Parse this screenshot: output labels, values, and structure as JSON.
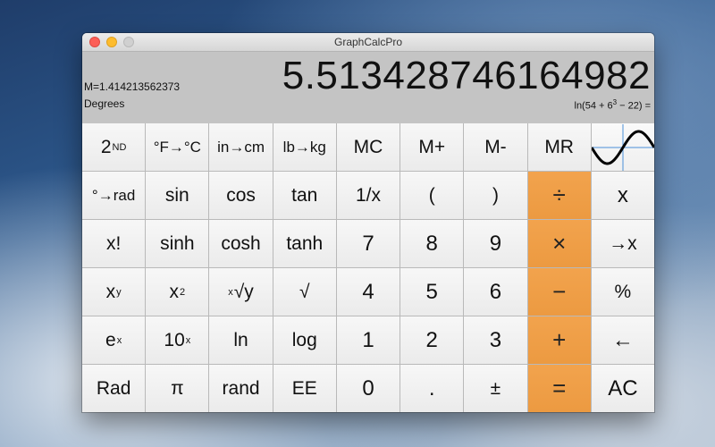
{
  "window": {
    "title": "GraphCalcPro"
  },
  "display": {
    "memory": "M=1.414213562373",
    "mode": "Degrees",
    "value": "5.5134287461649 82",
    "expression_parts": [
      "ln(54 + 6",
      "3",
      " − 22) ="
    ]
  },
  "keypad": {
    "rows": [
      [
        {
          "base": "2",
          "sup": "ND",
          "name": "second-function-button"
        },
        {
          "label": "°F→°C",
          "name": "fahrenheit-to-celsius-button",
          "size": "sm"
        },
        {
          "label": "in→cm",
          "name": "inches-to-cm-button",
          "size": "sm"
        },
        {
          "label": "lb→kg",
          "name": "pounds-to-kg-button",
          "size": "sm"
        },
        {
          "label": "MC",
          "name": "memory-clear-button"
        },
        {
          "label": "M+",
          "name": "memory-add-button"
        },
        {
          "label": "M-",
          "name": "memory-subtract-button"
        },
        {
          "label": "MR",
          "name": "memory-recall-button"
        },
        {
          "label": "",
          "name": "graph-button",
          "graph": true
        }
      ],
      [
        {
          "label": "°→rad",
          "name": "degrees-to-radians-button",
          "size": "sm"
        },
        {
          "label": "sin",
          "name": "sin-button"
        },
        {
          "label": "cos",
          "name": "cos-button"
        },
        {
          "label": "tan",
          "name": "tan-button"
        },
        {
          "label": "1/x",
          "name": "reciprocal-button"
        },
        {
          "label": "(",
          "name": "open-paren-button"
        },
        {
          "label": ")",
          "name": "close-paren-button"
        },
        {
          "label": "÷",
          "name": "divide-button",
          "op": true
        },
        {
          "label": "x",
          "name": "variable-x-button",
          "size": "lg"
        }
      ],
      [
        {
          "label": "x!",
          "name": "factorial-button"
        },
        {
          "label": "sinh",
          "name": "sinh-button"
        },
        {
          "label": "cosh",
          "name": "cosh-button"
        },
        {
          "label": "tanh",
          "name": "tanh-button"
        },
        {
          "label": "7",
          "name": "digit-7-button",
          "size": "lg"
        },
        {
          "label": "8",
          "name": "digit-8-button",
          "size": "lg"
        },
        {
          "label": "9",
          "name": "digit-9-button",
          "size": "lg"
        },
        {
          "label": "×",
          "name": "multiply-button",
          "op": true
        },
        {
          "label": "→x",
          "name": "store-x-button"
        }
      ],
      [
        {
          "base": "x",
          "sup": "y",
          "name": "power-button"
        },
        {
          "base": "x",
          "sup": "2",
          "name": "square-button"
        },
        {
          "pre": "x",
          "base": "√y",
          "name": "nth-root-button"
        },
        {
          "label": "√",
          "name": "square-root-button"
        },
        {
          "label": "4",
          "name": "digit-4-button",
          "size": "lg"
        },
        {
          "label": "5",
          "name": "digit-5-button",
          "size": "lg"
        },
        {
          "label": "6",
          "name": "digit-6-button",
          "size": "lg"
        },
        {
          "label": "−",
          "name": "minus-button",
          "op": true
        },
        {
          "label": "%",
          "name": "percent-button"
        }
      ],
      [
        {
          "base": "e",
          "sup": "x",
          "name": "exp-button"
        },
        {
          "base": "10",
          "sup": "x",
          "name": "ten-power-button"
        },
        {
          "label": "ln",
          "name": "ln-button"
        },
        {
          "label": "log",
          "name": "log-button"
        },
        {
          "label": "1",
          "name": "digit-1-button",
          "size": "lg"
        },
        {
          "label": "2",
          "name": "digit-2-button",
          "size": "lg"
        },
        {
          "label": "3",
          "name": "digit-3-button",
          "size": "lg"
        },
        {
          "label": "+",
          "name": "plus-button",
          "op": true
        },
        {
          "label": "←",
          "name": "backspace-button",
          "size": "lg"
        }
      ],
      [
        {
          "label": "Rad",
          "name": "radians-mode-button"
        },
        {
          "label": "π",
          "name": "pi-button"
        },
        {
          "label": "rand",
          "name": "random-button"
        },
        {
          "label": "EE",
          "name": "exponent-entry-button"
        },
        {
          "label": "0",
          "name": "digit-0-button",
          "size": "lg"
        },
        {
          "label": ".",
          "name": "decimal-button",
          "size": "lg"
        },
        {
          "label": "±",
          "name": "sign-toggle-button"
        },
        {
          "label": "=",
          "name": "equals-button",
          "op": true
        },
        {
          "label": "AC",
          "name": "all-clear-button",
          "size": "lg"
        }
      ]
    ]
  },
  "colors": {
    "operator_key": "#ef9d45",
    "key": "#f2f2f2",
    "graph_axis": "#4a90d9"
  },
  "icons": {
    "graph": "sine-wave-icon"
  }
}
